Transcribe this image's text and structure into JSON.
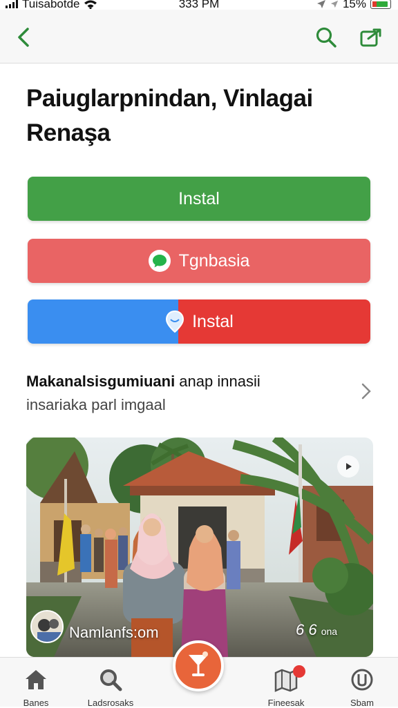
{
  "status_bar": {
    "carrier": "Tuisabotde",
    "time": "333 PM",
    "battery_percent": "15%",
    "icons": [
      "signal-icon",
      "wifi-icon",
      "location-icon",
      "battery-icon"
    ]
  },
  "nav": {
    "back_icon": "chevron-left-icon",
    "search_icon": "search-icon",
    "share_icon": "share-icon",
    "accent_color": "#2e8b3a"
  },
  "page": {
    "title": "Paiuglarpnindan, Vinlagai Renaşa"
  },
  "buttons": {
    "install_green_label": "Instal",
    "share_label": "Tgnbasia",
    "install_split_label": "Instal",
    "colors": {
      "green": "#43a047",
      "red": "#e96464",
      "blue": "#3a8ef0",
      "split_red": "#e53935"
    }
  },
  "info_row": {
    "line1_bold": "Makanalsisgumiuani",
    "line1_rest": " anap innasii",
    "line2": "insariaka parl imgaal"
  },
  "photo": {
    "caption": "Namlanfs:om",
    "meta": "6 6 ",
    "meta_small": "ona"
  },
  "tab_bar": {
    "tabs": [
      {
        "label": "Banes",
        "icon": "home-icon"
      },
      {
        "label": "Ladsrosaks",
        "icon": "search-icon"
      },
      {
        "label": "Fineesak",
        "icon": "map-icon"
      },
      {
        "label": "Sbam",
        "icon": "power-icon"
      }
    ],
    "fab_icon": "cocktail-icon",
    "fab_color": "#e8653a"
  }
}
